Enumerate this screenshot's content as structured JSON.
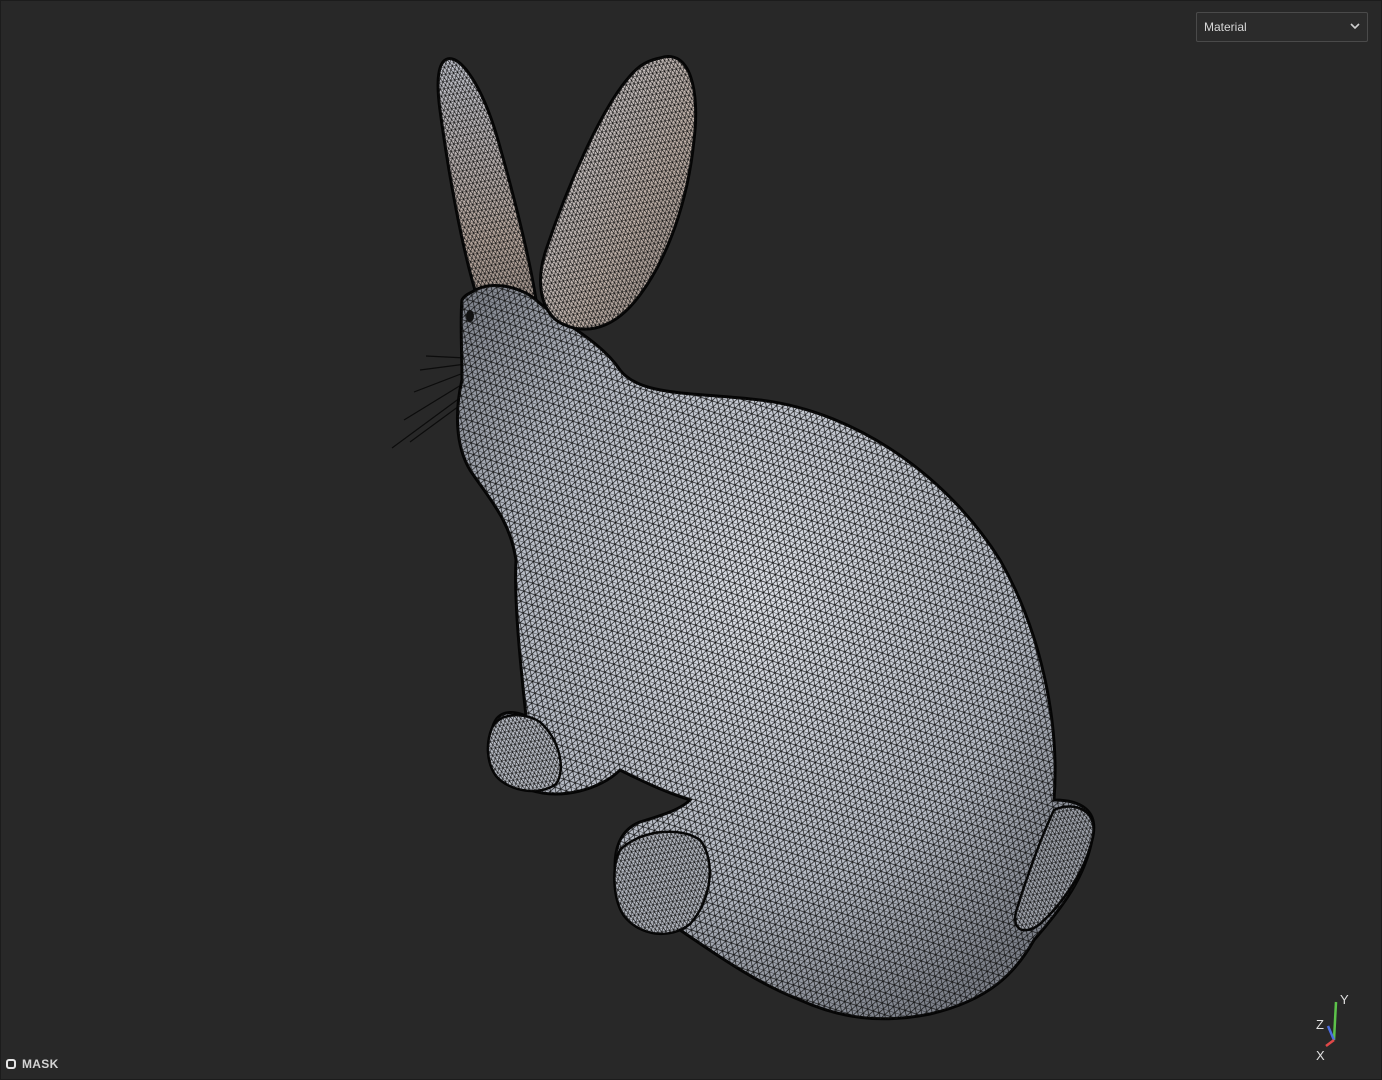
{
  "viewport": {
    "shading_mode": {
      "selected": "Material"
    },
    "model_name": "",
    "mask": {
      "label": "MASK"
    },
    "axis_gizmo": {
      "x_label": "X",
      "y_label": "Y",
      "z_label": "Z",
      "x_color": "#e04848",
      "y_color": "#5cc24a",
      "z_color": "#4a6de0"
    },
    "icons": [
      "chevron-down-icon",
      "mask-checkbox-icon"
    ],
    "colors": {
      "background": "#282828",
      "mesh_fill": "#c9cdd6",
      "wireframe": "#111111"
    }
  }
}
